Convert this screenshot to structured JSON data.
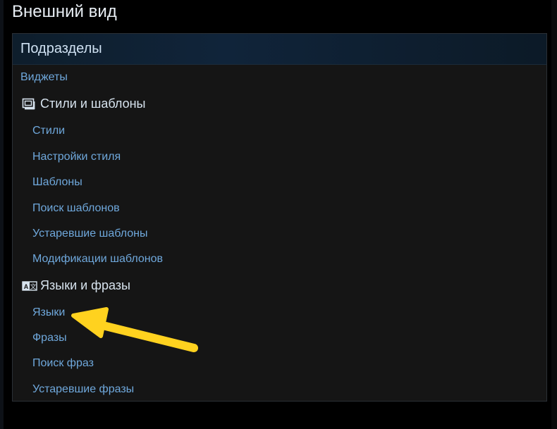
{
  "page": {
    "title": "Внешний вид"
  },
  "panel": {
    "header": "Подразделы",
    "top_item": "Виджеты",
    "groups": [
      {
        "title": "Стили и шаблоны",
        "icon": "styles-templates-icon",
        "items": [
          "Стили",
          "Настройки стиля",
          "Шаблоны",
          "Поиск шаблонов",
          "Устаревшие шаблоны",
          "Модификации шаблонов"
        ]
      },
      {
        "title": "Языки и фразы",
        "icon": "language-icon",
        "items": [
          "Языки",
          "Фразы",
          "Поиск фраз",
          "Устаревшие фразы"
        ]
      }
    ]
  },
  "colors": {
    "link": "#6fa8dc",
    "heading": "#d7e3ee",
    "annotation_arrow": "#ffd21f"
  }
}
